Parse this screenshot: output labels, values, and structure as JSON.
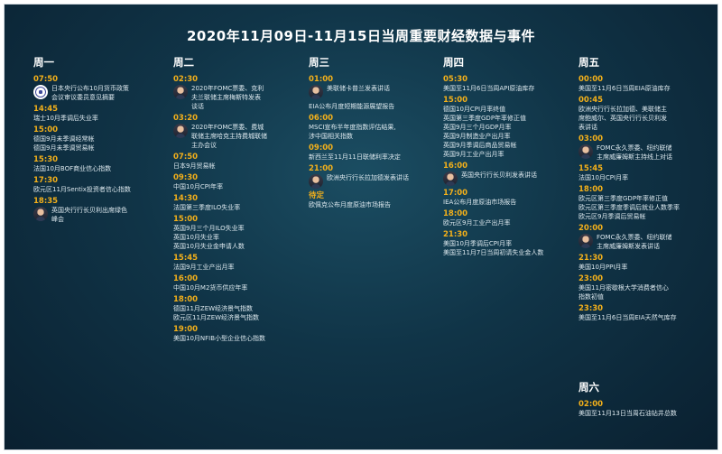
{
  "title": "2020年11月09日-11月15日当周重要财经数据与事件",
  "columns": [
    {
      "day": "周一",
      "events": [
        {
          "time": "07:50",
          "avatar": "emblem-icon",
          "items": [
            "日本央行公布10月货币政策",
            "会议审议委员意见摘要"
          ]
        },
        {
          "time": "14:45",
          "items": [
            "瑞士10月季调后失业率"
          ]
        },
        {
          "time": "15:00",
          "items": [
            "德国9月未季调经常帐",
            "德国9月未季调贸易帐"
          ]
        },
        {
          "time": "15:30",
          "items": [
            "法国10月BOF商业信心指数"
          ]
        },
        {
          "time": "17:30",
          "items": [
            "欧元区11月Sentix投资者信心指数"
          ]
        },
        {
          "time": "18:35",
          "avatar": "portrait-icon",
          "items": [
            "英国央行行长贝利出席绿色",
            "峰会"
          ]
        }
      ]
    },
    {
      "day": "周二",
      "events": [
        {
          "time": "02:30",
          "avatar": "portrait-icon",
          "items": [
            "2020年FOMC票委、克利",
            "夫兰联储主席梅斯特发表",
            "谈话"
          ]
        },
        {
          "time": "03:20",
          "avatar": "portrait-icon",
          "items": [
            "2020年FOMC票委、费城",
            "联储主席哈克主持费城联储",
            "主办会议"
          ]
        },
        {
          "time": "07:50",
          "items": [
            "日本9月贸易帐"
          ]
        },
        {
          "time": "09:30",
          "items": [
            "中国10月CPI年率"
          ]
        },
        {
          "time": "14:30",
          "items": [
            "法国第三季度ILO失业率"
          ]
        },
        {
          "time": "15:00",
          "items": [
            "英国9月三个月ILO失业率",
            "英国10月失业率",
            "英国10月失业金申请人数"
          ]
        },
        {
          "time": "15:45",
          "items": [
            "法国9月工业产出月率"
          ]
        },
        {
          "time": "16:00",
          "items": [
            "中国10月M2货币供应年率"
          ]
        },
        {
          "time": "18:00",
          "items": [
            "德国11月ZEW经济景气指数",
            "欧元区11月ZEW经济景气指数"
          ]
        },
        {
          "time": "19:00",
          "items": [
            "美国10月NFIB小型企业信心指数"
          ]
        }
      ]
    },
    {
      "day": "周三",
      "events": [
        {
          "time": "01:00",
          "avatar": "portrait-icon",
          "items": [
            "美联储卡普兰发表讲话"
          ]
        },
        {
          "time": "",
          "items": [
            "EIA公布月度短期能源展望报告"
          ]
        },
        {
          "time": "06:00",
          "items": [
            "MSCI宣布半年度指数评估结果,",
            "涉中国相关指数"
          ]
        },
        {
          "time": "09:00",
          "items": [
            "新西兰至11月11日联储利率决定"
          ]
        },
        {
          "time": "21:00",
          "avatar": "portrait-icon",
          "items": [
            "欧洲央行行长拉加德发表讲话"
          ]
        },
        {
          "time": "待定",
          "items": [
            "欧佩克公布月度原油市场报告"
          ]
        }
      ]
    },
    {
      "day": "周四",
      "events": [
        {
          "time": "05:30",
          "items": [
            "美国至11月6日当周API原油库存"
          ]
        },
        {
          "time": "15:00",
          "items": [
            "德国10月CPI月率终值",
            "英国第三季度GDP年率修正值",
            "英国9月三个月GDP月率",
            "英国9月制造业产出月率",
            "英国9月季调后商品贸易帐",
            "英国9月工业产出月率"
          ]
        },
        {
          "time": "16:00",
          "avatar": "portrait-icon",
          "items": [
            "英国央行行长贝利发表讲话"
          ]
        },
        {
          "time": "17:00",
          "items": [
            "IEA公布月度原油市场报告"
          ]
        },
        {
          "time": "18:00",
          "items": [
            "欧元区9月工业产出月率"
          ]
        },
        {
          "time": "21:30",
          "items": [
            "美国10月季调后CPI月率",
            "美国至11月7日当周初请失业金人数"
          ]
        }
      ]
    },
    {
      "day": "周五",
      "events": [
        {
          "time": "00:00",
          "items": [
            "美国至11月6日当周EIA原油库存"
          ]
        },
        {
          "time": "00:45",
          "items": [
            "欧洲央行行长拉加德、美联储主",
            "席鲍威尔、英国央行行长贝利发",
            "表讲话"
          ]
        },
        {
          "time": "03:00",
          "avatar": "portrait-icon",
          "items": [
            "FOMC永久票委、纽约联储",
            "主席威廉姆斯主持线上对话"
          ]
        },
        {
          "time": "15:45",
          "items": [
            "法国10月CPI月率"
          ]
        },
        {
          "time": "18:00",
          "items": [
            "欧元区第三季度GDP年率修正值",
            "欧元区第三季度季调后就业人数季率",
            "欧元区9月季调后贸易帐"
          ]
        },
        {
          "time": "20:00",
          "avatar": "portrait-icon",
          "items": [
            "FOMC永久票委、纽约联储",
            "主席威廉姆斯发表讲话"
          ]
        },
        {
          "time": "21:30",
          "items": [
            "美国10月PPI月率"
          ]
        },
        {
          "time": "23:00",
          "items": [
            "美国11月密歇根大学消费者信心",
            "指数初值"
          ]
        },
        {
          "time": "23:30",
          "items": [
            "美国至11月6日当周EIA天然气库存"
          ]
        }
      ]
    },
    {
      "day": "周六",
      "events": [
        {
          "time": "02:00",
          "items": [
            "美国至11月13日当周石油钻井总数"
          ]
        }
      ]
    }
  ]
}
